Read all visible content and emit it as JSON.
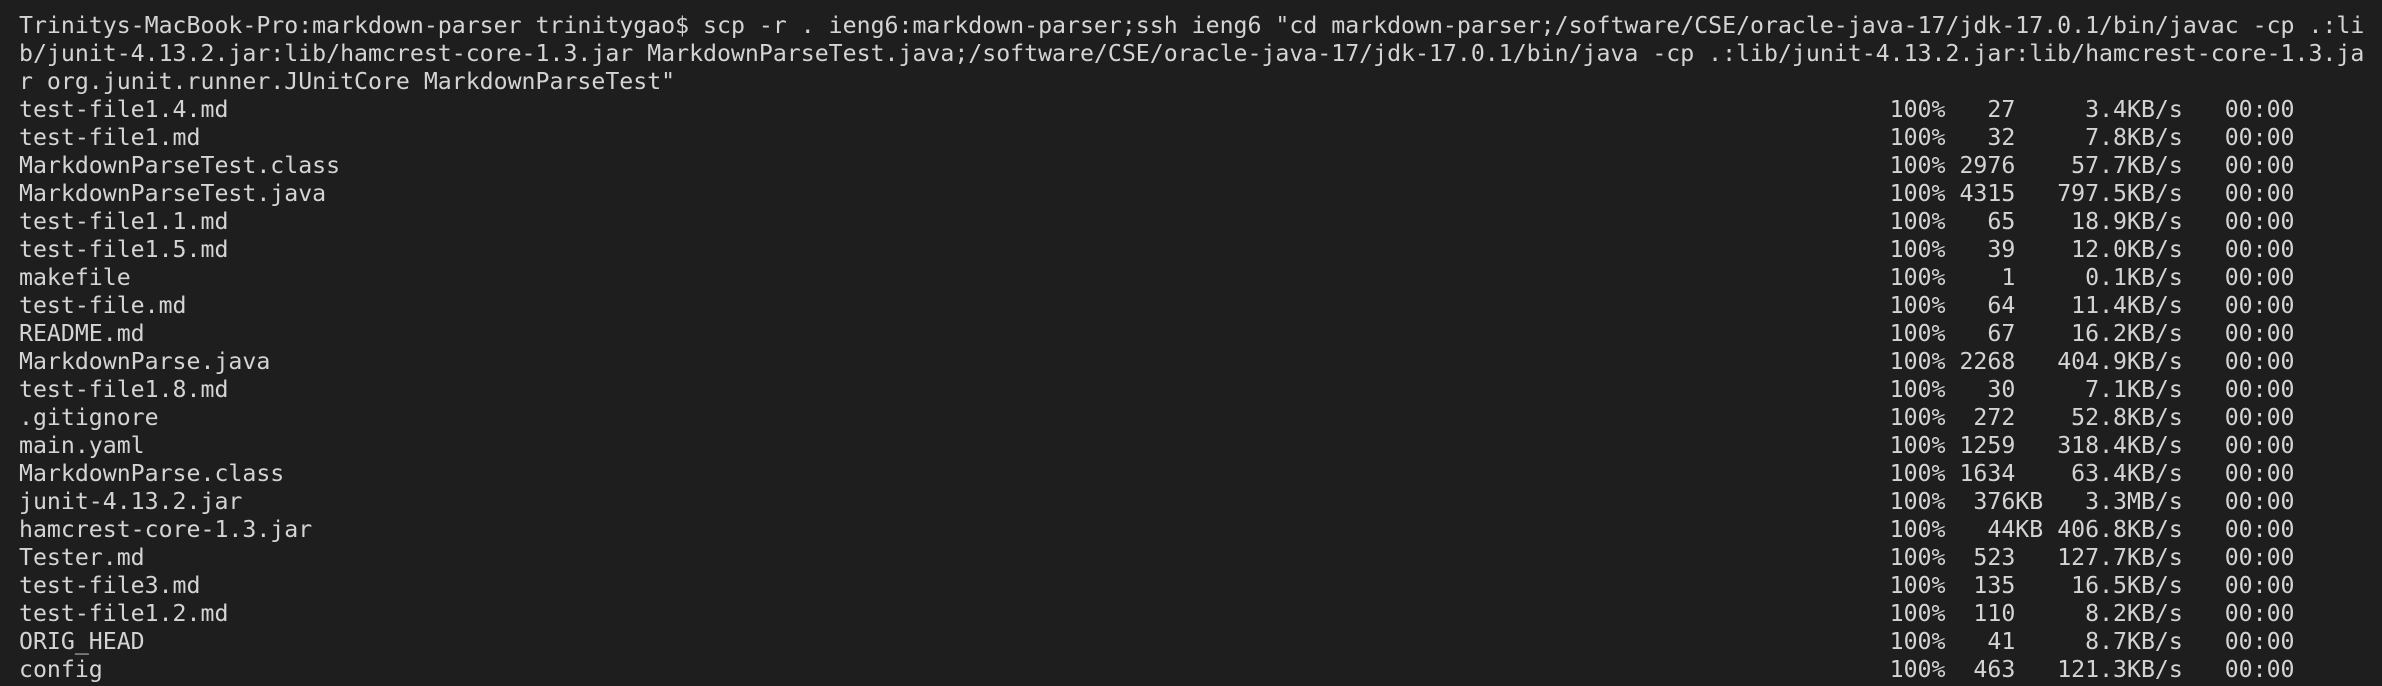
{
  "terminal": {
    "prompt": "Trinitys-MacBook-Pro:markdown-parser trinitygao$ ",
    "command": "scp -r . ieng6:markdown-parser;ssh ieng6 \"cd markdown-parser;/software/CSE/oracle-java-17/jdk-17.0.1/bin/javac -cp .:lib/junit-4.13.2.jar:lib/hamcrest-core-1.3.jar MarkdownParseTest.java;/software/CSE/oracle-java-17/jdk-17.0.1/bin/java -cp .:lib/junit-4.13.2.jar:lib/hamcrest-core-1.3.jar org.junit.runner.JUnitCore MarkdownParseTest\"",
    "colors": {
      "background": "#1e1e1e",
      "text": "#d4d4d4"
    },
    "transfers": [
      {
        "file": "test-file1.4.md",
        "percent": "100%",
        "size": "27",
        "speed": "3.4KB/s",
        "eta": "00:00"
      },
      {
        "file": "test-file1.md",
        "percent": "100%",
        "size": "32",
        "speed": "7.8KB/s",
        "eta": "00:00"
      },
      {
        "file": "MarkdownParseTest.class",
        "percent": "100%",
        "size": "2976",
        "speed": "57.7KB/s",
        "eta": "00:00"
      },
      {
        "file": "MarkdownParseTest.java",
        "percent": "100%",
        "size": "4315",
        "speed": "797.5KB/s",
        "eta": "00:00"
      },
      {
        "file": "test-file1.1.md",
        "percent": "100%",
        "size": "65",
        "speed": "18.9KB/s",
        "eta": "00:00"
      },
      {
        "file": "test-file1.5.md",
        "percent": "100%",
        "size": "39",
        "speed": "12.0KB/s",
        "eta": "00:00"
      },
      {
        "file": "makefile",
        "percent": "100%",
        "size": "1",
        "speed": "0.1KB/s",
        "eta": "00:00"
      },
      {
        "file": "test-file.md",
        "percent": "100%",
        "size": "64",
        "speed": "11.4KB/s",
        "eta": "00:00"
      },
      {
        "file": "README.md",
        "percent": "100%",
        "size": "67",
        "speed": "16.2KB/s",
        "eta": "00:00"
      },
      {
        "file": "MarkdownParse.java",
        "percent": "100%",
        "size": "2268",
        "speed": "404.9KB/s",
        "eta": "00:00"
      },
      {
        "file": "test-file1.8.md",
        "percent": "100%",
        "size": "30",
        "speed": "7.1KB/s",
        "eta": "00:00"
      },
      {
        "file": ".gitignore",
        "percent": "100%",
        "size": "272",
        "speed": "52.8KB/s",
        "eta": "00:00"
      },
      {
        "file": "main.yaml",
        "percent": "100%",
        "size": "1259",
        "speed": "318.4KB/s",
        "eta": "00:00"
      },
      {
        "file": "MarkdownParse.class",
        "percent": "100%",
        "size": "1634",
        "speed": "63.4KB/s",
        "eta": "00:00"
      },
      {
        "file": "junit-4.13.2.jar",
        "percent": "100%",
        "size": "376KB",
        "speed": "3.3MB/s",
        "eta": "00:00"
      },
      {
        "file": "hamcrest-core-1.3.jar",
        "percent": "100%",
        "size": "44KB",
        "speed": "406.8KB/s",
        "eta": "00:00"
      },
      {
        "file": "Tester.md",
        "percent": "100%",
        "size": "523",
        "speed": "127.7KB/s",
        "eta": "00:00"
      },
      {
        "file": "test-file3.md",
        "percent": "100%",
        "size": "135",
        "speed": "16.5KB/s",
        "eta": "00:00"
      },
      {
        "file": "test-file1.2.md",
        "percent": "100%",
        "size": "110",
        "speed": "8.2KB/s",
        "eta": "00:00"
      },
      {
        "file": "ORIG_HEAD",
        "percent": "100%",
        "size": "41",
        "speed": "8.7KB/s",
        "eta": "00:00"
      },
      {
        "file": "config",
        "percent": "100%",
        "size": "463",
        "speed": "121.3KB/s",
        "eta": "00:00"
      }
    ]
  }
}
